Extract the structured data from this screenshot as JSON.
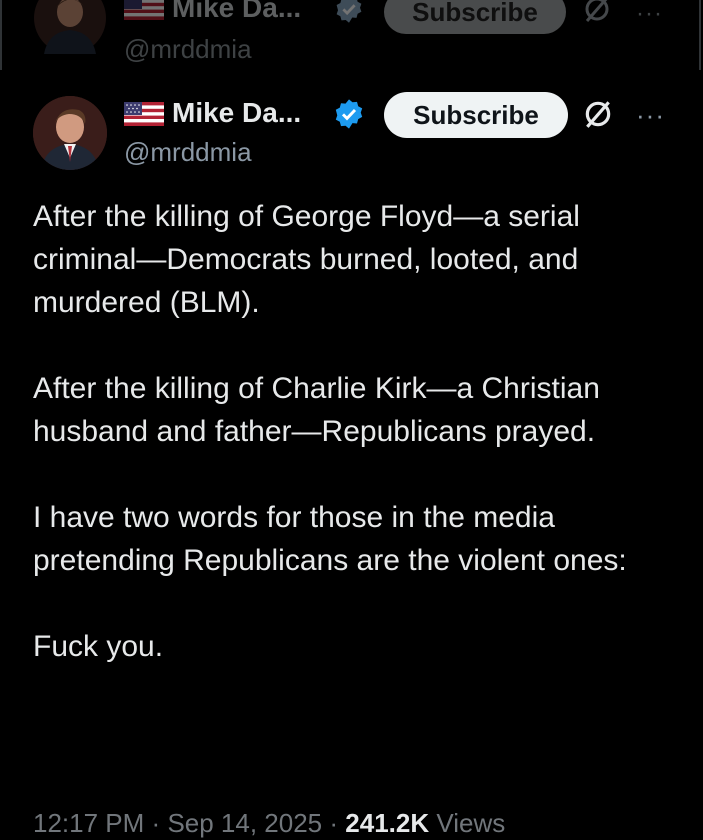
{
  "ghost_header": {
    "display_name": "Mike Da...",
    "handle": "@mrddmia",
    "subscribe_label": "Subscribe"
  },
  "header": {
    "display_name": "Mike Da...",
    "handle": "@mrddmia",
    "subscribe_label": "Subscribe",
    "more_label": "···"
  },
  "tweet": {
    "paragraphs": [
      "After the killing of George Floyd—a serial criminal—Democrats burned, looted, and murdered (BLM).",
      "After the killing of Charlie Kirk—a Christian husband and father—Republicans prayed.",
      "I have two words for those in the media pretending Republicans are the violent ones:",
      "Fuck you."
    ]
  },
  "meta": {
    "time": "12:17 PM",
    "separator": "·",
    "date": "Sep 14, 2025",
    "views_count": "241.2K",
    "views_label": "Views"
  },
  "colors": {
    "background": "#000000",
    "text": "#e7e9ea",
    "secondary_text": "#71767b",
    "verified": "#1d9bf0",
    "subscribe_bg": "#eff3f4"
  }
}
